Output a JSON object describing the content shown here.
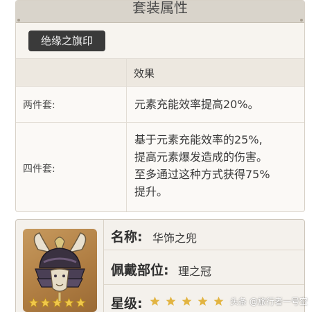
{
  "set_panel": {
    "title": "套装属性",
    "set_name": "绝缘之旗印",
    "column_header": "效果",
    "bonuses": [
      {
        "pieces": "两件套:",
        "lines": [
          "元素充能效率提高20%。"
        ]
      },
      {
        "pieces": "四件套:",
        "lines": [
          "基于元素充能效率的25%,",
          "提高元素爆发造成的伤害。",
          "至多通过这种方式获得75%",
          "提升。"
        ]
      }
    ]
  },
  "artifact": {
    "name_label": "名称:",
    "name_value": "华饰之兜",
    "slot_label": "佩戴部位:",
    "slot_value": "理之冠",
    "rarity_label": "星级:",
    "rarity": 5,
    "thumb_stars": 5,
    "icon": "samurai-helmet-icon",
    "star_icon": "star-icon"
  },
  "watermark": "头条 @旅行者一号空",
  "colors": {
    "star": "#e2b441",
    "tag_bg": "#3a3a3a",
    "header_bg": "#d9d4cb",
    "thumb_bg": "#b07e43"
  }
}
